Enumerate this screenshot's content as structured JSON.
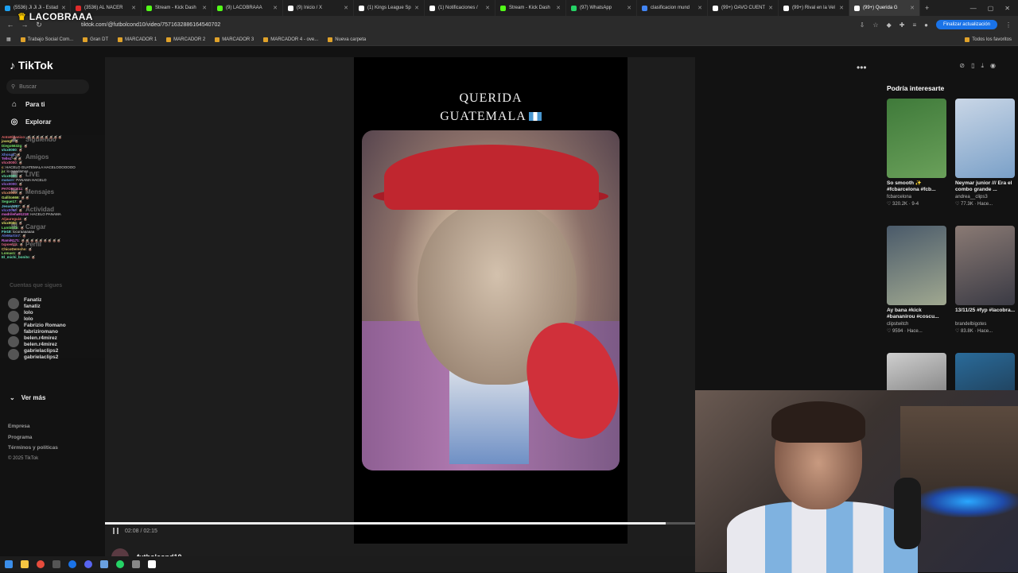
{
  "browser": {
    "tabs": [
      {
        "label": "(5536) Ji Ji Ji - Estad",
        "color": "#1da1f2"
      },
      {
        "label": "(3536) AL NACER",
        "color": "#e02b2b"
      },
      {
        "label": "Stream - Kick Dash",
        "color": "#53fc18"
      },
      {
        "label": "(9) LACOBRAAA",
        "color": "#53fc18"
      },
      {
        "label": "(9) Inicio / X",
        "color": "#ffffff"
      },
      {
        "label": "(1) Kings League Sp",
        "color": "#ffffff"
      },
      {
        "label": "(1) Notificaciones /",
        "color": "#ffffff"
      },
      {
        "label": "Stream - Kick Dash",
        "color": "#53fc18"
      },
      {
        "label": "(97) WhatsApp",
        "color": "#25d366"
      },
      {
        "label": "clasificacion mund",
        "color": "#4285f4"
      },
      {
        "label": "(99+) OAVO CUENT",
        "color": "#ffffff"
      },
      {
        "label": "(99+) Rival en la Vel",
        "color": "#ffffff"
      },
      {
        "label": "(99+) Querida G",
        "color": "#ffffff",
        "active": true
      }
    ],
    "url": "tiktok.com/@futbolcond10/video/7571632886164540702",
    "update_label": "Finalizar actualización",
    "bookmarks": [
      "Trabajo Social Com...",
      "Gran DT",
      "MARCADOR 1",
      "MARCADOR 2",
      "MARCADOR 3",
      "MARCADOR 4 - ove...",
      "Nueva carpeta"
    ],
    "all_bookmarks": "Todos los favoritos"
  },
  "overlay": {
    "stream_name": "LACOBRAAA"
  },
  "sidebar": {
    "logo": "TikTok",
    "search_placeholder": "Buscar",
    "items": [
      {
        "label": "Para ti",
        "icon": "home-icon"
      },
      {
        "label": "Explorar",
        "icon": "compass-icon"
      },
      {
        "label": "Siguiendo",
        "icon": "following-icon"
      },
      {
        "label": "Amigos",
        "icon": "friends-icon"
      },
      {
        "label": "LIVE",
        "icon": "live-icon"
      },
      {
        "label": "Mensajes",
        "icon": "message-icon"
      },
      {
        "label": "Actividad",
        "icon": "activity-icon"
      },
      {
        "label": "Cargar",
        "icon": "upload-icon"
      },
      {
        "label": "Perfil",
        "icon": "profile-icon"
      }
    ],
    "following_title": "Cuentas que sigues",
    "following": [
      {
        "name": "Fanatiz",
        "handle": "fanatiz"
      },
      {
        "name": "lolo",
        "handle": "lolo"
      },
      {
        "name": "Fabrizio Romano",
        "handle": "fabriziromano"
      },
      {
        "name": "belen.r4mirez",
        "handle": "belen.r4mirez"
      },
      {
        "name": "gabrielaclips2",
        "handle": "gabrielaclips2"
      }
    ],
    "see_more": "Ver más",
    "footer": [
      "Empresa",
      "Programa",
      "Términos y políticas"
    ],
    "copyright": "© 2025 TikTok"
  },
  "chat": [
    {
      "user": "AntoElpanico",
      "msg": "🧉🧉🧉🧉🧉🧉🧉🧉"
    },
    {
      "user": "joangf",
      "msg": "🧉"
    },
    {
      "user": "Diego5632g",
      "msg": "🧉"
    },
    {
      "user": "vlcx0000",
      "msg": "🧉"
    },
    {
      "user": "Xhonas",
      "msg": "🧉"
    },
    {
      "user": "Tellez",
      "msg": "🧉🧉"
    },
    {
      "user": "vlcx0000",
      "msg": "🧉"
    },
    {
      "user": "c",
      "msg": "HACELO GUATEMALA HACELOOOOOOO"
    },
    {
      "user": "ju",
      "msg": "lo mandamos"
    },
    {
      "user": "vlcx0000",
      "msg": "🧉"
    },
    {
      "user": "matarrr",
      "msg": "PANAMA HACELO"
    },
    {
      "user": "vlcx0000",
      "msg": "🧉"
    },
    {
      "user": "PATORCE11",
      "msg": "🧉"
    },
    {
      "user": "vlcx0000",
      "msg": "🧉"
    },
    {
      "user": "Gallito666",
      "msg": "🧉🧉"
    },
    {
      "user": "Segue17",
      "msg": "🧉"
    },
    {
      "user": "Jesus1007",
      "msg": "🧉🧉"
    },
    {
      "user": "vlcx0000",
      "msg": "🧉"
    },
    {
      "user": "madrileña91218",
      "msg": "HACELO PANAMA"
    },
    {
      "user": "Aljauregui4",
      "msg": "🧉"
    },
    {
      "user": "vlcx0000",
      "msg": "🧉"
    },
    {
      "user": "Lumberlo",
      "msg": "🧉"
    },
    {
      "user": "Fie18",
      "msg": "locuraaaaaaa"
    },
    {
      "user": "AleMartin7",
      "msg": "🧉"
    },
    {
      "user": "RamiN171",
      "msg": "🧉🧉🧉🧉🧉🧉🧉🧉🧉"
    },
    {
      "user": "txpoenza",
      "msg": "🧉"
    },
    {
      "user": "ChicoDerecho",
      "msg": "🧉"
    },
    {
      "user": "Lomas1",
      "msg": "🧉"
    },
    {
      "user": "El_michi_bonito",
      "msg": "🧉"
    }
  ],
  "video": {
    "title_line1": "QUERIDA",
    "title_line2": "GUATEMALA",
    "current_time": "02:08",
    "duration": "02:15",
    "time_display": "02:08 / 02:15",
    "progress": 0.95,
    "author": "futbolcond10"
  },
  "recommendations": {
    "title": "Podría interesarte",
    "cards": [
      {
        "title": "So smooth ✨ #fcbarcelona #fcb...",
        "author": "fcbarcelona",
        "stats": "♡ 320.2K · 9-4",
        "colors": [
          "#3f7a3a",
          "#6aa05a"
        ]
      },
      {
        "title": "Neymar junior /// Era el combo grande ...",
        "author": "andrea__clips3",
        "stats": "♡ 77.3K · Hace...",
        "colors": [
          "#c9d6e6",
          "#7aa0c8"
        ]
      },
      {
        "title": "Ay bana #kick #bananirou #coscu...",
        "author": "clipstwitch",
        "stats": "♡ 9594 · Hace...",
        "colors": [
          "#4a5a6a",
          "#a0a890"
        ]
      },
      {
        "title": "13/11/25 #fyp #lacobra...",
        "author": "brandelbigotes",
        "stats": "♡ 83.8K · Hace...",
        "colors": [
          "#8a7a74",
          "#3a3a44"
        ]
      },
      {
        "title": "",
        "author": "",
        "stats": "",
        "colors": [
          "#cfcfcf",
          "#5a5a5a"
        ]
      },
      {
        "title": "",
        "author": "",
        "stats": "",
        "colors": [
          "#2a6b9a",
          "#1a2a3a"
        ]
      }
    ]
  },
  "colors": {
    "background": "#121212",
    "accent_red": "#fe2c55",
    "update_button": "#1a73e8"
  }
}
